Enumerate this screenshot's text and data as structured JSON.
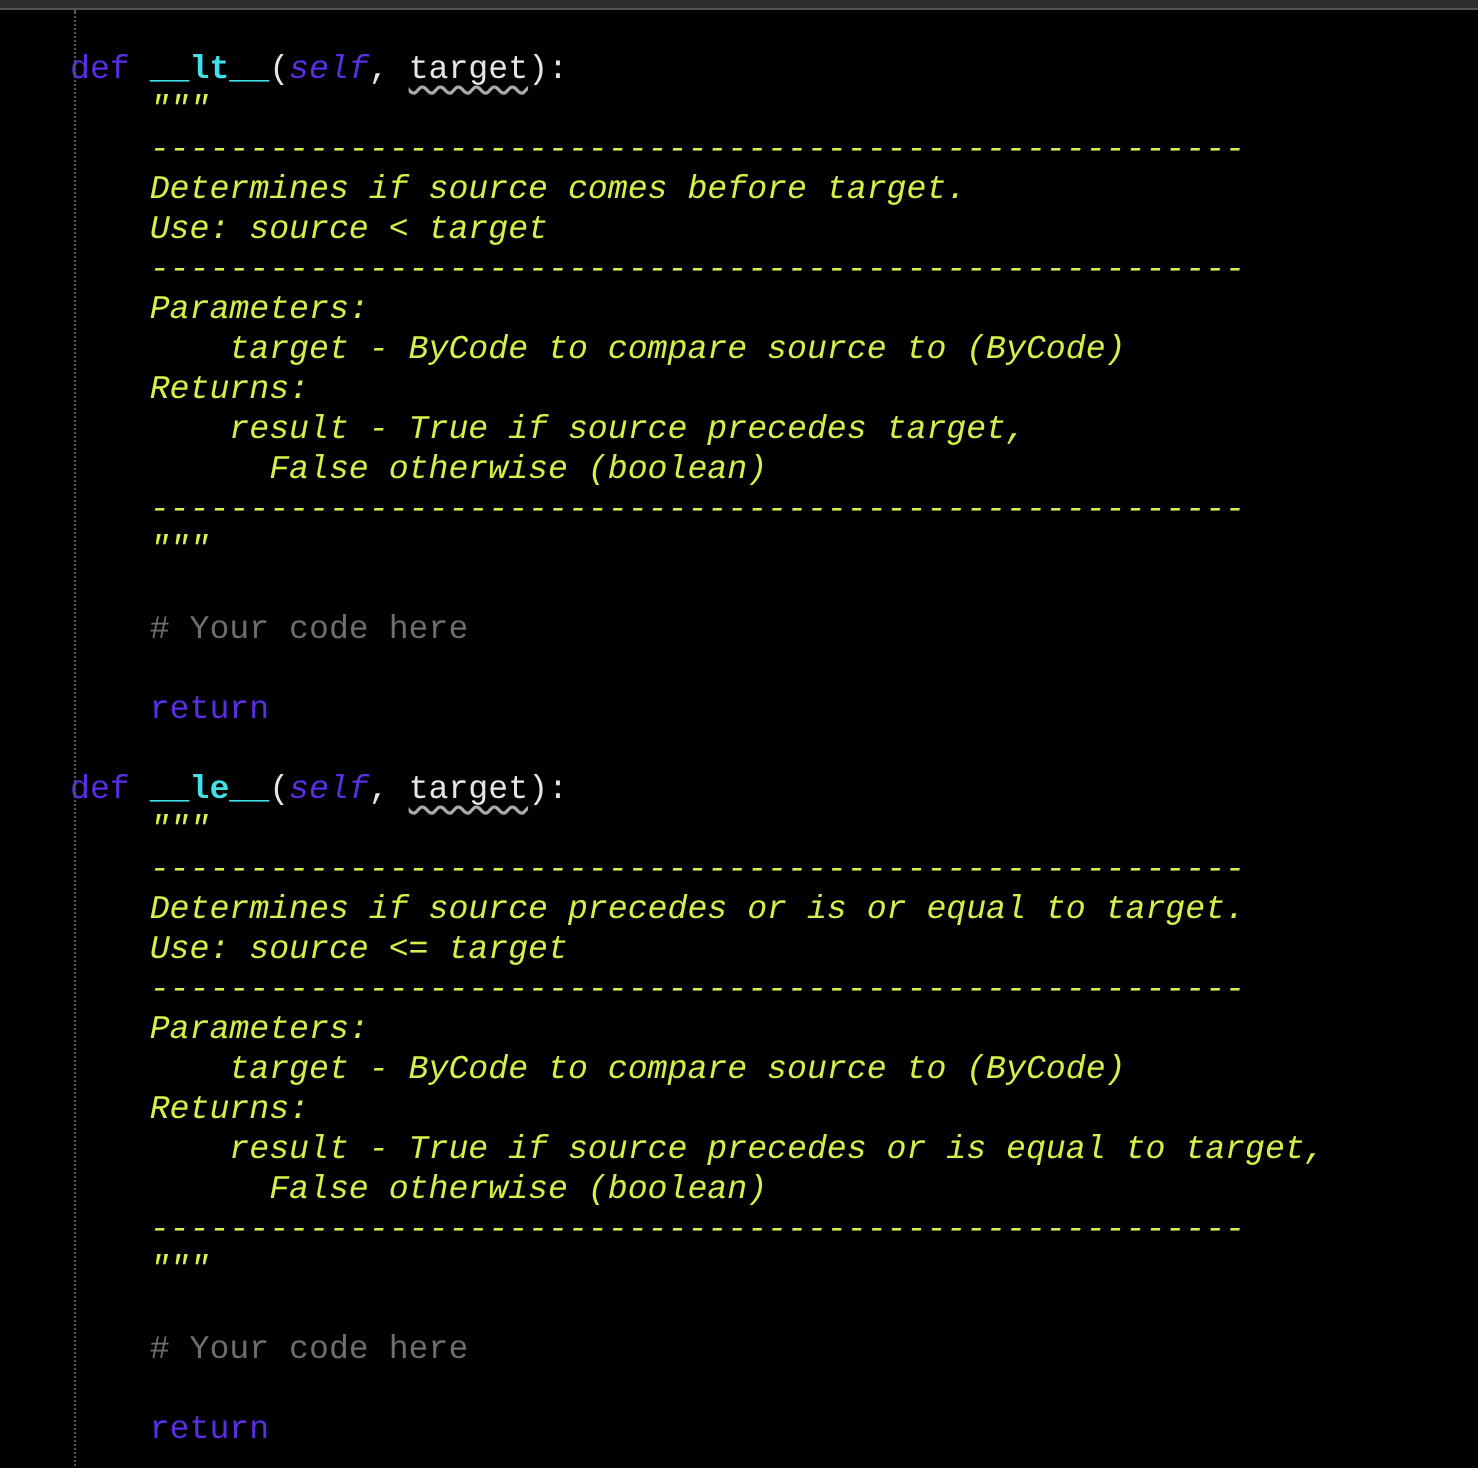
{
  "editor": {
    "lines": [
      {
        "kind": "code",
        "tokens": [
          {
            "kind": "keyword",
            "text": "def"
          },
          {
            "kind": "function",
            "text": "__lt__"
          },
          {
            "kind": "plain",
            "text": "("
          },
          {
            "kind": "self",
            "text": "self",
            "warning": false
          },
          {
            "kind": "plain",
            "text": ", "
          },
          {
            "kind": "plain",
            "text": "target",
            "warning": true
          },
          {
            "kind": "plain",
            "text": "):"
          }
        ]
      },
      {
        "kind": "code",
        "tokens": [
          {
            "kind": "docstring",
            "text": "    \"\"\""
          }
        ]
      },
      {
        "kind": "code",
        "tokens": [
          {
            "kind": "docstring",
            "text": "    -------------------------------------------------------"
          }
        ]
      },
      {
        "kind": "code",
        "tokens": [
          {
            "kind": "docstring",
            "text": "    Determines if source comes before target."
          }
        ]
      },
      {
        "kind": "code",
        "tokens": [
          {
            "kind": "docstring",
            "text": "    Use: source < target"
          }
        ]
      },
      {
        "kind": "code",
        "tokens": [
          {
            "kind": "docstring",
            "text": "    -------------------------------------------------------"
          }
        ]
      },
      {
        "kind": "code",
        "tokens": [
          {
            "kind": "docstring",
            "text": "    Parameters:"
          }
        ]
      },
      {
        "kind": "code",
        "tokens": [
          {
            "kind": "docstring",
            "text": "        target - ByCode to compare source to (ByCode)"
          }
        ]
      },
      {
        "kind": "code",
        "tokens": [
          {
            "kind": "docstring",
            "text": "    Returns:"
          }
        ]
      },
      {
        "kind": "code",
        "tokens": [
          {
            "kind": "docstring",
            "text": "        result - True if source precedes target,"
          }
        ]
      },
      {
        "kind": "code",
        "tokens": [
          {
            "kind": "docstring",
            "text": "          False otherwise (boolean)"
          }
        ]
      },
      {
        "kind": "code",
        "tokens": [
          {
            "kind": "docstring",
            "text": "    -------------------------------------------------------"
          }
        ]
      },
      {
        "kind": "code",
        "tokens": [
          {
            "kind": "docstring",
            "text": "    \"\"\""
          }
        ]
      },
      {
        "kind": "blank"
      },
      {
        "kind": "code",
        "tokens": [
          {
            "kind": "comment",
            "text": "    # Your code here"
          }
        ]
      },
      {
        "kind": "blank"
      },
      {
        "kind": "code",
        "tokens": [
          {
            "kind": "keyword",
            "text": "    return"
          }
        ]
      },
      {
        "kind": "blank"
      },
      {
        "kind": "code",
        "tokens": [
          {
            "kind": "keyword",
            "text": "def"
          },
          {
            "kind": "function",
            "text": "__le__"
          },
          {
            "kind": "plain",
            "text": "("
          },
          {
            "kind": "self",
            "text": "self",
            "warning": false
          },
          {
            "kind": "plain",
            "text": ", "
          },
          {
            "kind": "plain",
            "text": "target",
            "warning": true
          },
          {
            "kind": "plain",
            "text": "):"
          }
        ]
      },
      {
        "kind": "code",
        "tokens": [
          {
            "kind": "docstring",
            "text": "    \"\"\""
          }
        ]
      },
      {
        "kind": "code",
        "tokens": [
          {
            "kind": "docstring",
            "text": "    -------------------------------------------------------"
          }
        ]
      },
      {
        "kind": "code",
        "tokens": [
          {
            "kind": "docstring",
            "text": "    Determines if source precedes or is or equal to target."
          }
        ]
      },
      {
        "kind": "code",
        "tokens": [
          {
            "kind": "docstring",
            "text": "    Use: source <= target"
          }
        ]
      },
      {
        "kind": "code",
        "tokens": [
          {
            "kind": "docstring",
            "text": "    -------------------------------------------------------"
          }
        ]
      },
      {
        "kind": "code",
        "tokens": [
          {
            "kind": "docstring",
            "text": "    Parameters:"
          }
        ]
      },
      {
        "kind": "code",
        "tokens": [
          {
            "kind": "docstring",
            "text": "        target - ByCode to compare source to (ByCode)"
          }
        ]
      },
      {
        "kind": "code",
        "tokens": [
          {
            "kind": "docstring",
            "text": "    Returns:"
          }
        ]
      },
      {
        "kind": "code",
        "tokens": [
          {
            "kind": "docstring",
            "text": "        result - True if source precedes or is equal to target,"
          }
        ]
      },
      {
        "kind": "code",
        "tokens": [
          {
            "kind": "docstring",
            "text": "          False otherwise (boolean)"
          }
        ]
      },
      {
        "kind": "code",
        "tokens": [
          {
            "kind": "docstring",
            "text": "    -------------------------------------------------------"
          }
        ]
      },
      {
        "kind": "code",
        "tokens": [
          {
            "kind": "docstring",
            "text": "    \"\"\""
          }
        ]
      },
      {
        "kind": "blank"
      },
      {
        "kind": "code",
        "tokens": [
          {
            "kind": "comment",
            "text": "    # Your code here"
          }
        ]
      },
      {
        "kind": "blank"
      },
      {
        "kind": "code",
        "tokens": [
          {
            "kind": "keyword",
            "text": "    return"
          }
        ]
      }
    ]
  }
}
